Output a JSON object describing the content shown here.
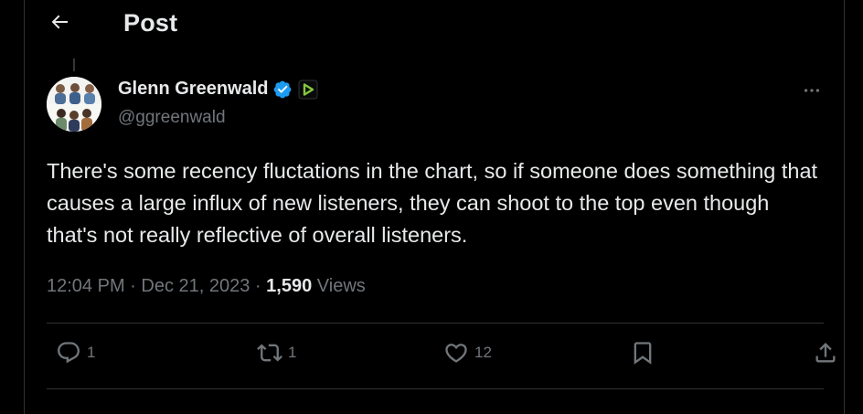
{
  "header": {
    "title": "Post",
    "back_icon": "arrow-left-icon"
  },
  "tweet": {
    "author": {
      "name": "Glenn Greenwald",
      "handle": "@ggreenwald",
      "verified_icon": "verified-badge-icon",
      "affiliate_icon": "rumble-affiliate-icon"
    },
    "text": "There's some recency fluctations in the chart, so if someone does something that causes a large influx of new listeners, they can shoot to the top even though that's not really reflective of overall listeners.",
    "time": "12:04 PM",
    "sep1": " · ",
    "date": "Dec 21, 2023",
    "sep2": " · ",
    "views_count": "1,590",
    "views_label": " Views",
    "more_icon": "more-options-icon"
  },
  "actions": {
    "reply_count": "1",
    "repost_count": "1",
    "like_count": "12"
  },
  "colors": {
    "background": "#000000",
    "text_primary": "#e7e9ea",
    "text_secondary": "#71767b",
    "divider": "#2f3336",
    "verified": "#1d9bf0",
    "affiliate": "#85c742"
  }
}
